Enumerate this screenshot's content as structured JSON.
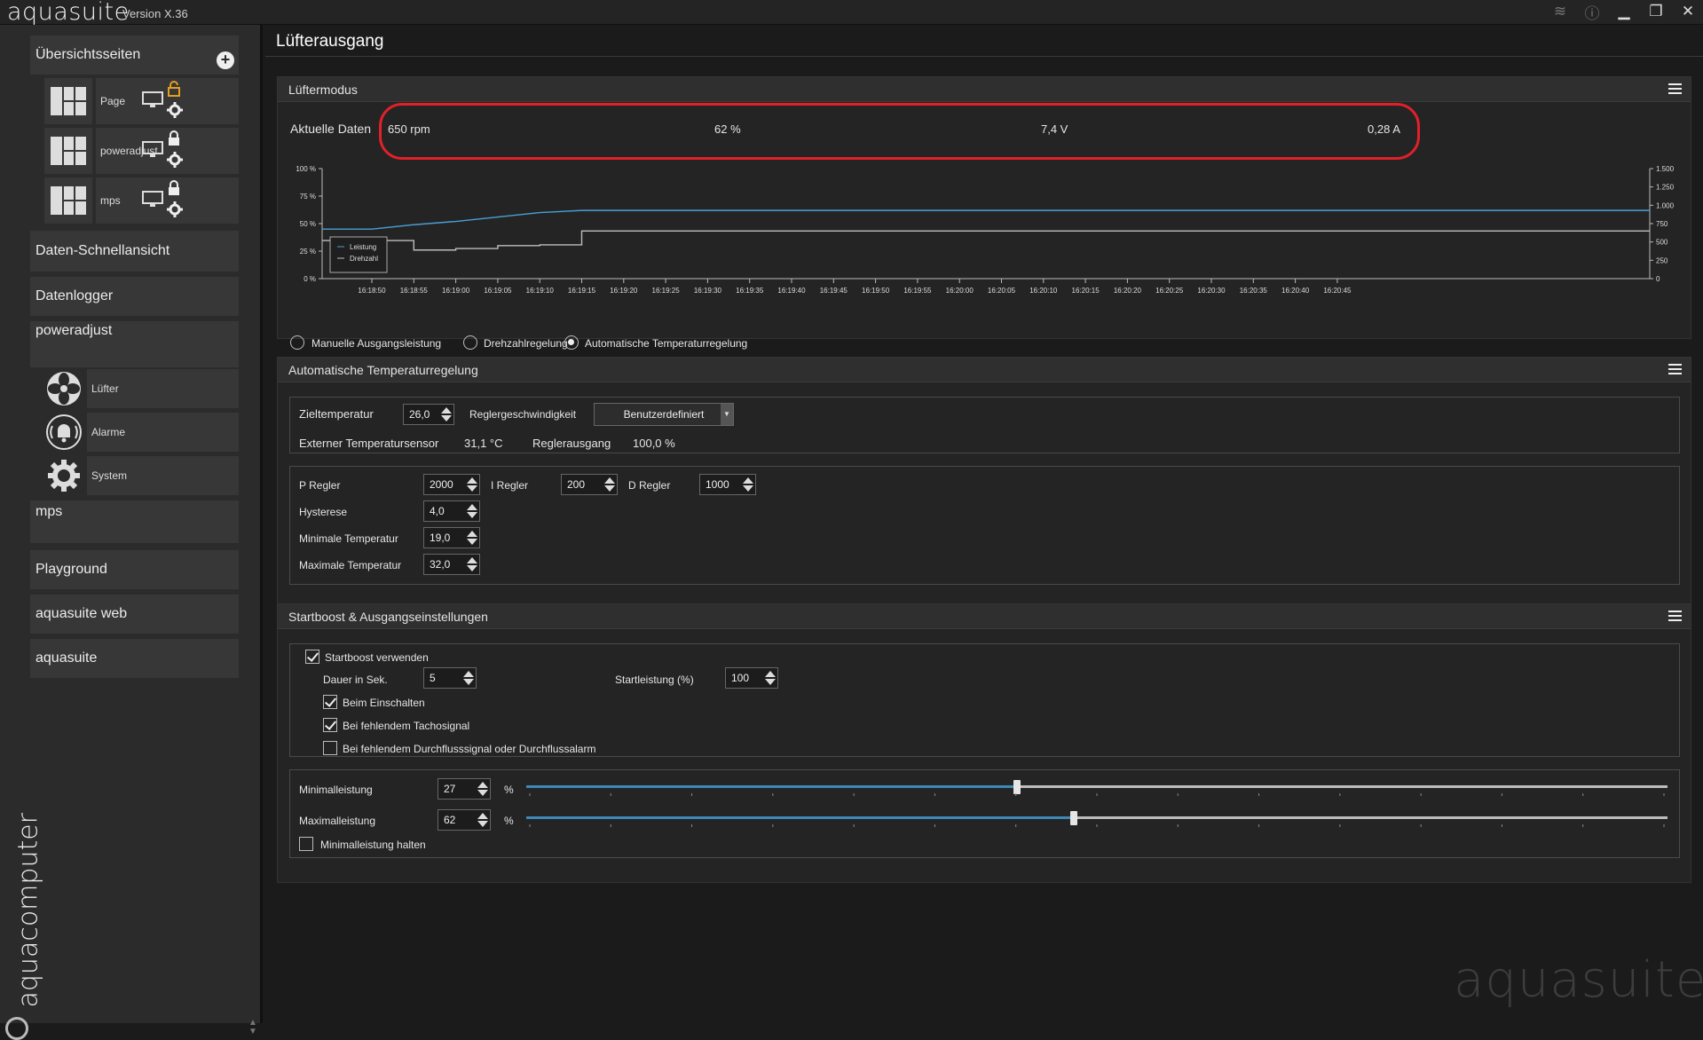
{
  "app": {
    "name": "aquasuite",
    "version": "Version X.36",
    "brand_vertical": "aquacomputer",
    "watermark": "aquasuite"
  },
  "window_controls": [
    "layers-icon",
    "info-icon",
    "minimize-icon",
    "restore-icon",
    "close-icon"
  ],
  "sidebar": {
    "overview_label": "Übersichtsseiten",
    "pages": [
      {
        "label": "Page",
        "locked": false
      },
      {
        "label": "poweradjust",
        "locked": true
      },
      {
        "label": "mps",
        "locked": true
      }
    ],
    "quick_view": "Daten-Schnellansicht",
    "data_logger": "Datenlogger",
    "device_group": "poweradjust",
    "device_items": [
      {
        "label": "Lüfter",
        "icon": "fan-icon"
      },
      {
        "label": "Alarme",
        "icon": "alarm-bell-icon"
      },
      {
        "label": "System",
        "icon": "gear-icon"
      }
    ],
    "mps": "mps",
    "playground": "Playground",
    "aquasuite_web": "aquasuite web",
    "aquasuite": "aquasuite"
  },
  "main": {
    "title": "Lüfterausgang",
    "fan_mode": {
      "title": "Lüftermodus",
      "current_label": "Aktuelle Daten",
      "rpm": "650 rpm",
      "percent": "62 %",
      "voltage": "7,4 V",
      "current": "0,28 A",
      "modes": [
        {
          "label": "Manuelle Ausgangsleistung",
          "selected": false
        },
        {
          "label": "Drehzahlregelung",
          "selected": false
        },
        {
          "label": "Automatische Temperaturregelung",
          "selected": true
        }
      ]
    },
    "temp_control": {
      "title": "Automatische Temperaturregelung",
      "target_label": "Zieltemperatur",
      "target_value": "26,0",
      "speed_label": "Reglergeschwindigkeit",
      "speed_value": "Benutzerdefiniert",
      "sensor_label": "Externer Temperatursensor",
      "sensor_value": "31,1 °C",
      "output_label": "Reglerausgang",
      "output_value": "100,0 %",
      "p_label": "P Regler",
      "p_value": "2000",
      "i_label": "I Regler",
      "i_value": "200",
      "d_label": "D Regler",
      "d_value": "1000",
      "hyst_label": "Hysterese",
      "hyst_value": "4,0",
      "min_temp_label": "Minimale Temperatur",
      "min_temp_value": "19,0",
      "max_temp_label": "Maximale Temperatur",
      "max_temp_value": "32,0"
    },
    "startboost": {
      "title": "Startboost & Ausgangseinstellungen",
      "use_label": "Startboost verwenden",
      "use_checked": true,
      "duration_label": "Dauer in Sek.",
      "duration_value": "5",
      "start_power_label": "Startleistung (%)",
      "start_power_value": "100",
      "on_power_label": "Beim Einschalten",
      "on_power_checked": true,
      "tacho_label": "Bei fehlendem Tachosignal",
      "tacho_checked": true,
      "flow_label": "Bei fehlendem Durchflusssignal oder Durchflussalarm",
      "flow_checked": false,
      "min_label": "Minimalleistung",
      "min_value": "27",
      "min_fraction": 0.43,
      "max_label": "Maximalleistung",
      "max_value": "62",
      "max_fraction": 0.48,
      "unit": "%",
      "hold_min_label": "Minimalleistung halten",
      "hold_min_checked": false
    }
  },
  "chart_data": {
    "type": "line",
    "x": [
      "16:18:50",
      "16:18:55",
      "16:19:00",
      "16:19:05",
      "16:19:10",
      "16:19:15",
      "16:19:20",
      "16:19:25",
      "16:19:30",
      "16:19:35",
      "16:19:40",
      "16:19:45",
      "16:19:50",
      "16:19:55",
      "16:20:00",
      "16:20:05",
      "16:20:10",
      "16:20:15",
      "16:20:20",
      "16:20:25",
      "16:20:30",
      "16:20:35",
      "16:20:40",
      "16:20:45"
    ],
    "left_ticks": [
      "100 %",
      "75 %",
      "50 %",
      "25 %",
      "0 %"
    ],
    "right_ticks": [
      "1.500",
      "1.250",
      "1.000",
      "750",
      "500",
      "250",
      "0"
    ],
    "ylim_left": [
      0,
      100
    ],
    "ylim_right": [
      0,
      1500
    ],
    "series": [
      {
        "name": "Leistung",
        "axis": "left",
        "color": "#4a9fd6",
        "values": [
          45,
          49,
          52,
          56,
          60,
          62,
          62,
          62,
          62,
          62,
          62,
          62,
          62,
          62,
          62,
          62,
          62,
          62,
          62,
          62,
          62,
          62,
          62,
          62
        ]
      },
      {
        "name": "Drehzahl",
        "axis": "right",
        "color": "#bdbdbd",
        "values": [
          520,
          390,
          410,
          450,
          460,
          650,
          650,
          650,
          650,
          650,
          650,
          650,
          650,
          650,
          650,
          650,
          650,
          650,
          650,
          650,
          650,
          650,
          650,
          650
        ]
      }
    ],
    "legend": "bottom-left"
  }
}
